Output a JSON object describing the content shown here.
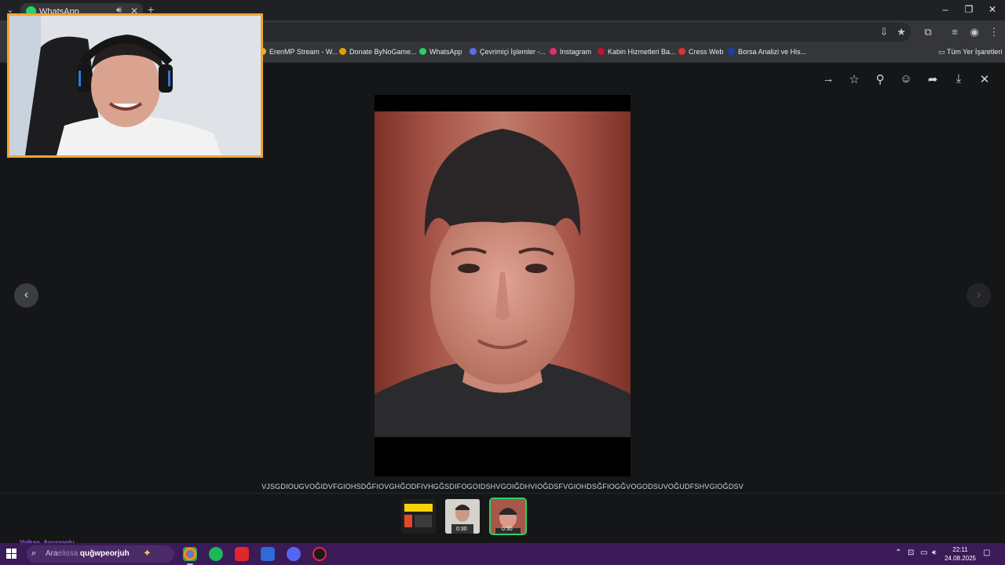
{
  "browser": {
    "tab_title": "WhatsApp",
    "window_controls": {
      "minimize": "–",
      "restore": "❐",
      "close": "✕"
    }
  },
  "bookmarks": [
    {
      "label": "ErenMP Stream - W...",
      "color": "#f4b400"
    },
    {
      "label": "Donate ByNoGame...",
      "color": "#e0a000"
    },
    {
      "label": "WhatsApp",
      "color": "#25d366"
    },
    {
      "label": "Çevrimiçi İşlemler -...",
      "color": "#5b6ee1"
    },
    {
      "label": "Instagram",
      "color": "#e1306c"
    },
    {
      "label": "Kabin Hizmetleri Ba...",
      "color": "#c8102e"
    },
    {
      "label": "Cress Web",
      "color": "#d9342b"
    },
    {
      "label": "Borsa Analizi ve His...",
      "color": "#1b3fa8"
    }
  ],
  "all_bookmarks_label": "Tüm Yer İşaretleri",
  "viewer": {
    "caption": "VJSGDIOUGVOĞIDVFGIOHSDĞFIOVGHĞODFIVHGĞSDIFOGOIDSHVGOIĞDHVIOĞDSFVGIOHDSĞFIOGĞVOGODSUVOĞUDFSHVGIOĞDSV",
    "thumbnails": [
      {
        "duration": "",
        "active": false
      },
      {
        "duration": "0:30",
        "active": false
      },
      {
        "duration": "0:30",
        "active": true
      }
    ]
  },
  "overlay": {
    "chat_username": "Volkan_Ayvazoglu"
  },
  "taskbar": {
    "search_placeholder": "Ara",
    "search_typed_dim": "elissa",
    "search_typed": "quğwpeorjuh",
    "time": "22:11",
    "date": "24.08.2025"
  },
  "colors": {
    "accent": "#25d366",
    "taskbar": "#3a1a57",
    "webcam_border": "#f0a532"
  }
}
